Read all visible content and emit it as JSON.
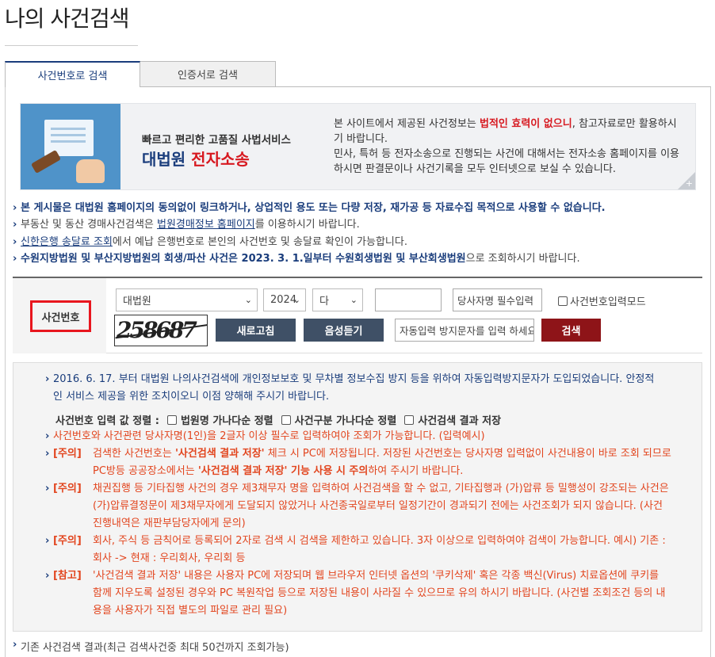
{
  "page": {
    "title": "나의 사건검색"
  },
  "tabs": [
    {
      "label": "사건번호로 검색",
      "active": true
    },
    {
      "label": "인증서로 검색",
      "active": false
    }
  ],
  "banner": {
    "subtitle": "빠르고 편리한 고품질 사법서비스",
    "brand_part1": "대법원",
    "brand_part2": "전자소송",
    "text_1": "본 사이트에서 제공된 사건정보는 ",
    "text_em": "법적인 효력이 없으니",
    "text_2": ", 참고자료로만 활용하시기 바랍니다.",
    "text_3": "민사, 특허 등 전자소송으로 진행되는 사건에 대해서는 전자소송 홈페이지를 이용하시면 판결문이나 사건기록을 모두 인터넷으로 보실 수 있습니다.",
    "plus": "+"
  },
  "notices": {
    "n1": "본 게시물은 대법원 홈페이지의 동의없이 링크하거나, 상업적인 용도 또는 다량 저장, 재가공 등 자료수집 목적으로 사용할 수 없습니다.",
    "n2_pre": "부동산 및 동산 경매사건검색은 ",
    "n2_link": "법원경매정보 홈페이지",
    "n2_post": "를 이용하시기 바랍니다.",
    "n3_link": "신한은행 송달료 조회",
    "n3_post": "에서 예납 은행번호로 본인의 사건번호 및 송달료 확인이 가능합니다.",
    "n4_b1": "수원지방법원 및 부산지방법원의 회생/파산 사건은 2023. 3. 1.일부터 수원회생법원 및 부산회생법원",
    "n4_post": "으로 조회하시기 바랍니다."
  },
  "search": {
    "label": "사건번호",
    "court_value": "대법원",
    "year_value": "2024",
    "type_value": "다",
    "number_value": "",
    "party_placeholder": "당사자명 필수입력",
    "mode_label": "사건번호입력모드",
    "captcha_text": "258687",
    "refresh_label": "새로고침",
    "audio_label": "음성듣기",
    "captcha_placeholder": "자동입력 방지문자를 입력 하세요",
    "submit_label": "검색"
  },
  "info": {
    "intro": "2016. 6. 17. 부터 대법원 나의사건검색에 개인정보보호 및 무차별 정보수집 방지 등을 위하여 자동입력방지문자가 도입되었습니다. 안정적인 서비스 제공을 위한 조치이오니 이점 양해해 주시기 바랍니다.",
    "sort_label": "사건번호 입력 값 정렬 :",
    "sort_opt1": "법원명 가나다순 정렬",
    "sort_opt2": "사건구분 가나다순 정렬",
    "sort_opt3": "사건검색 결과 저장",
    "p1": "사건번호와 사건관련 당사자명(1인)을 2글자 이상 필수로 입력하여야 조회가 가능합니다. (입력예시)",
    "w1_tag": "[주의]",
    "w1_a": "검색한 사건번호는 ",
    "w1_b": "'사건검색 결과 저장'",
    "w1_c": " 체크 시 PC에 저장됩니다. 저장된 사건번호는 당사자명 입력없이 사건내용이 바로 조회 되므로 PC방등 공공장소에서는 ",
    "w1_d": "'사건검색 결과 저장' 기능 사용 시 주의",
    "w1_e": "하여 주시기 바랍니다.",
    "w2_tag": "[주의]",
    "w2": "채권집행 등 기타집행 사건의 경우 제3채무자 명을 입력하여 사건검색을 할 수 없고, 기타집행과 (가)압류 등 밀행성이 강조되는 사건은 (가)압류결정문이 제3채무자에게 도달되지 않았거나 사건종국일로부터 일정기간이 경과되기 전에는 사건조회가 되지 않습니다. (사건진행내역은 재판부담당자에게 문의)",
    "w3_tag": "[주의]",
    "w3": "회사, 주식 등 금칙어로 등록되어 2자로 검색 시 검색을 제한하고 있습니다. 3자 이상으로 입력하여야 검색이 가능합니다. 예시) 기존 : 회사 -> 현재 : 우리회사, 우리회 등",
    "n1_tag": "[참고]",
    "n1": "'사건검색 결과 저장' 내용은 사용자 PC에 저장되며 웹 브라우저 인터넷 옵션의 '쿠키삭제' 혹은 각종 백신(Virus) 치료옵션에 쿠키를 함께 지우도록 설정된 경우와 PC 복원작업 등으로 저장된 내용이 사라질 수 있으므로 유의 하시기 바랍니다. (사건별 조회조건 등의 내용을 사용자가 직접 별도의 파일로 관리 필요)"
  },
  "prev_result": "기존 사건검색 결과(최근 검색사건중 최대 50건까지 조회가능)"
}
